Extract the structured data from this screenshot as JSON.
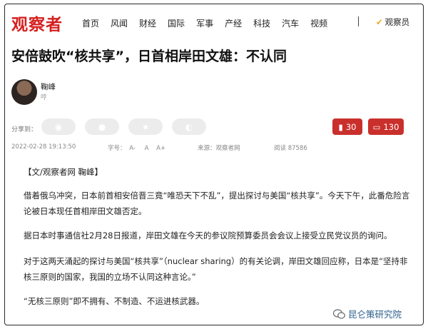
{
  "header": {
    "logo": "观察者",
    "nav": [
      "首页",
      "风闻",
      "财经",
      "国际",
      "军事",
      "产经",
      "科技",
      "汽车",
      "视频"
    ],
    "member_label": "观察员"
  },
  "article": {
    "title": "安倍鼓吹“核共享”，日首相岸田文雄：不认同",
    "author_name": "鞠峰",
    "author_sub": "哼",
    "share_label": "分享到：",
    "bookmark_count": "30",
    "comment_count": "130",
    "date": "2022-02-28 19:13:50",
    "font_size_label": "字号：",
    "font_sizes": [
      "A-",
      "A",
      "A+"
    ],
    "source": "来源：观察者网",
    "reads": "阅读 87586",
    "paragraphs": [
      "【文/观察者网 鞠峰】",
      "借着俄乌冲突，日本前首相安倍晋三竟“唯恐天下不乱”，提出探讨与美国“核共享”。今天下午，此番危险言论被日本现任首相岸田文雄否定。",
      "据日本时事通信社2月28日报道，岸田文雄在今天的参议院预算委员会会议上接受立民党议员的询问。",
      "对于这两天涌起的探讨与美国“核共享”（nuclear sharing）的有关论调，岸田文雄回应称，日本是“坚持非核三原则的国家，我国的立场不认同这种言论。”",
      "“无核三原则”即不拥有、不制造、不运进核武器。"
    ]
  },
  "watermark": "昆仑策研究院"
}
